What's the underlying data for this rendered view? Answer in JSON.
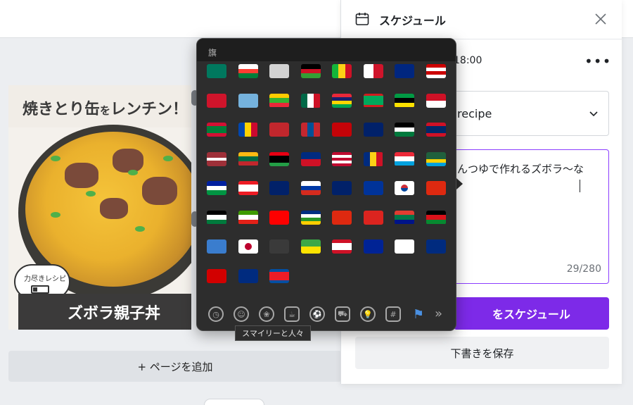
{
  "canvas": {
    "design_title_main": "焼きとり缶",
    "design_title_particle": "を",
    "design_title_rest": "レンチン！",
    "bubble_text": "力尽きレシピ",
    "banner_text": "ズボラ親子丼",
    "add_page_label": "+ ページを追加"
  },
  "schedule_panel": {
    "title": "スケジュール",
    "time": "18:00",
    "more": "•••",
    "channel": "recipe",
    "text": "んつゆで作れるズボラ〜な",
    "char_count": "29/280",
    "schedule_button": "をスケジュール",
    "save_button": "下書きを保存"
  },
  "emoji_picker": {
    "category_title": "旗",
    "tooltip": "スマイリーと人々",
    "more": "»",
    "flag_count": 59,
    "flags": [
      "macau",
      "madagascar",
      "malawi_alt",
      "malawi",
      "mali",
      "malta",
      "martinique",
      "malaysia",
      "isle_of_man",
      "micronesia",
      "myanmar",
      "mexico",
      "mauritius",
      "mauritania",
      "mozambique",
      "monaco",
      "maldives",
      "moldova",
      "morocco",
      "mongolia",
      "montenegro",
      "montserrat",
      "jordan",
      "laos",
      "latvia",
      "lithuania",
      "libya",
      "liechtenstein",
      "liberia",
      "romania",
      "luxembourg",
      "rwanda",
      "lesotho",
      "lebanon",
      "uk",
      "russia",
      "cayman",
      "eu",
      "south_korea",
      "hong_kong",
      "western_sahara",
      "equatorial_guinea",
      "taiwan",
      "central_african_republic",
      "china",
      "east_timor",
      "south_africa",
      "south_sudan",
      "antarctica",
      "japan",
      "crossed_flags",
      "french_guiana",
      "french_polynesia",
      "french_southern",
      "virgin_islands",
      "american_samoa",
      "north_macedonia",
      "nauru",
      "north_korea"
    ],
    "categories": [
      "recent-icon",
      "smiley-icon",
      "animal-icon",
      "food-icon",
      "activity-icon",
      "travel-icon",
      "objects-icon",
      "symbols-icon",
      "flags-icon"
    ]
  },
  "colors": {
    "accent": "#7d2ae8",
    "picker_bg": "#2d2d2d"
  }
}
